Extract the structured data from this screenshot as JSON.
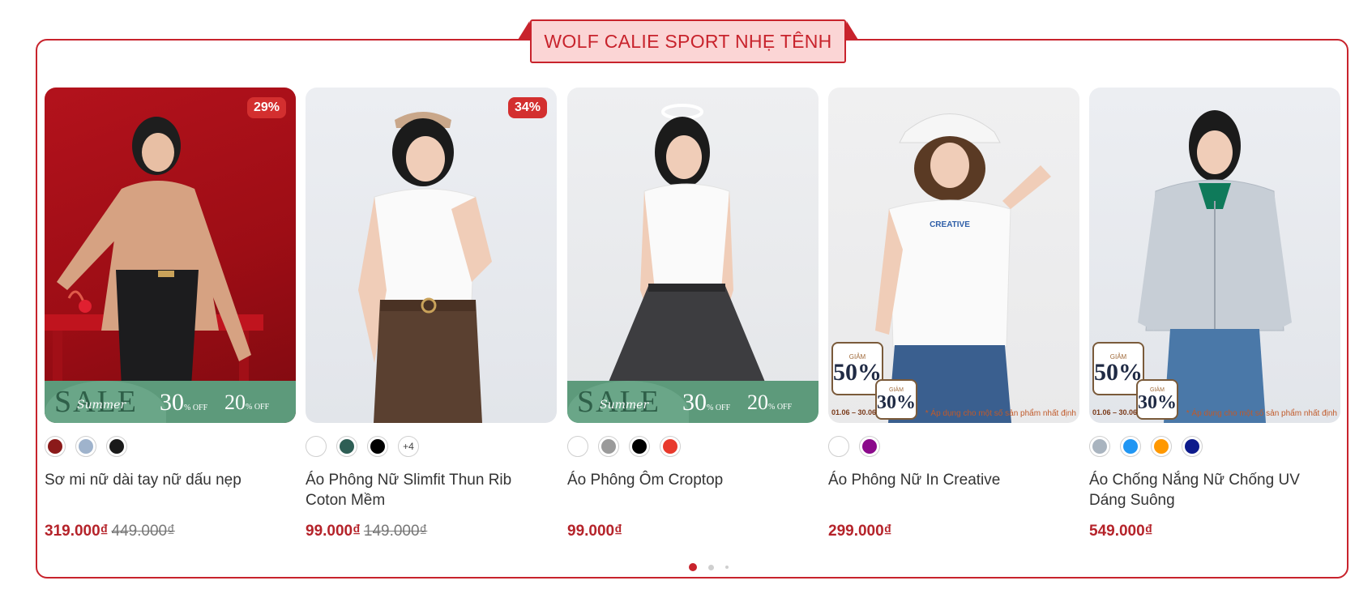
{
  "section": {
    "title": "WOLF CALIE SPORT NHẸ TÊNH"
  },
  "products": [
    {
      "name": "Sơ mi nữ dài tay nữ dấu nẹp",
      "price": "319.000₫",
      "old_price": "449.000₫",
      "discount": "29%",
      "swatches": [
        "#8b1a1a",
        "#9fb3cc",
        "#1a1a1a"
      ],
      "more": "",
      "banner": {
        "sale": "SALE",
        "script": "Summer",
        "p1": "30",
        "p2": "20",
        "off": "% OFF"
      }
    },
    {
      "name": "Áo Phông Nữ Slimfit Thun Rib Coton Mềm",
      "price": "99.000₫",
      "old_price": "149.000₫",
      "discount": "34%",
      "swatches": [
        "#ffffff",
        "#2e5e55",
        "#000000"
      ],
      "more": "+4"
    },
    {
      "name": "Áo Phông Ôm Croptop",
      "price": "99.000₫",
      "old_price": "",
      "discount": "",
      "swatches": [
        "#ffffff",
        "#9a9a9a",
        "#000000",
        "#e8392c"
      ],
      "more": "",
      "banner": {
        "sale": "SALE",
        "script": "Summer",
        "p1": "30",
        "p2": "20",
        "off": "% OFF"
      }
    },
    {
      "name": "Áo Phông Nữ In Creative",
      "price": "299.000₫",
      "old_price": "",
      "discount": "",
      "swatches": [
        "#ffffff",
        "#8b0a8b"
      ],
      "more": "",
      "promo": {
        "label": "GIẢM",
        "big": "50%",
        "small": "30%",
        "dates": "01.06 – 30.06",
        "note": "* Áp dụng cho một số sản phẩm nhất định",
        "print": "CREATIVE"
      }
    },
    {
      "name": "Áo Chống Nắng Nữ Chống UV Dáng Suông",
      "price": "549.000₫",
      "old_price": "",
      "discount": "",
      "swatches": [
        "#a9b4bf",
        "#2196f3",
        "#ff9800",
        "#0d1b8c"
      ],
      "more": "",
      "promo": {
        "label": "GIẢM",
        "big": "50%",
        "small": "30%",
        "dates": "01.06 – 30.06",
        "note": "* Áp dụng cho một số sản phẩm nhất định"
      }
    }
  ],
  "pagination": {
    "count": 3,
    "active": 1
  }
}
